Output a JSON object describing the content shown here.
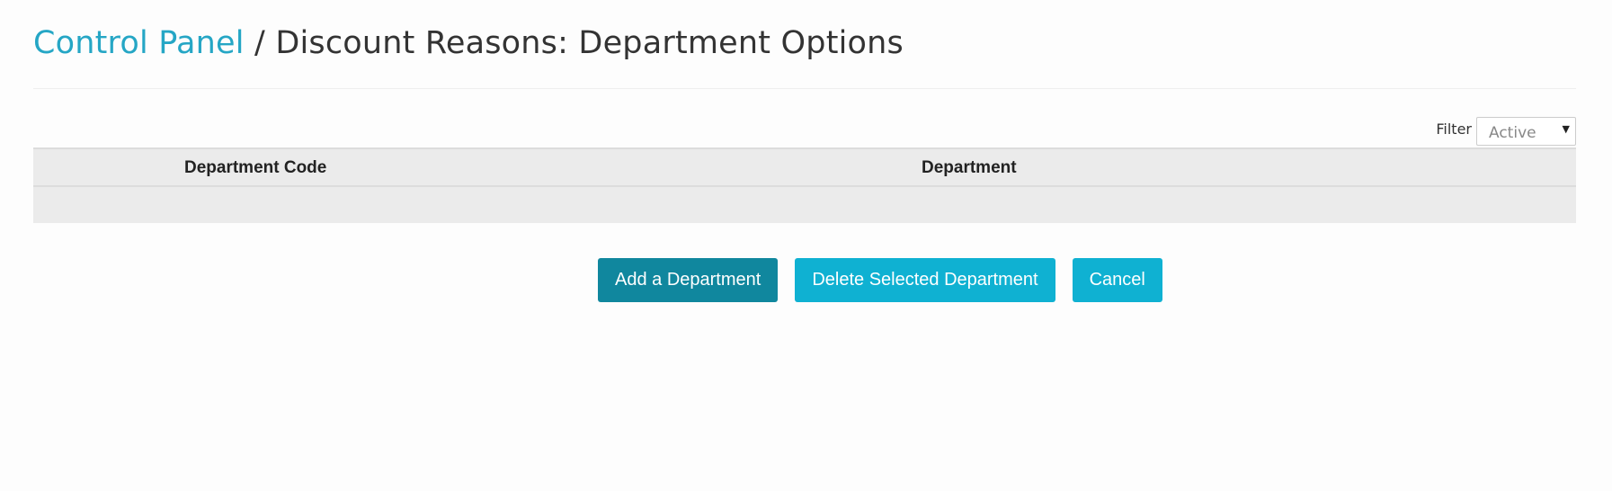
{
  "breadcrumb": {
    "root_label": "Control Panel",
    "separator": "/",
    "current_label": "Discount Reasons: Department Options"
  },
  "filter": {
    "label": "Filter",
    "selected": "Active"
  },
  "table": {
    "columns": [
      "Department Code",
      "Department"
    ],
    "rows": []
  },
  "actions": {
    "add_label": "Add a Department",
    "delete_label": "Delete Selected Department",
    "cancel_label": "Cancel"
  },
  "colors": {
    "link": "#25a6c5",
    "primary_button": "#10879e",
    "info_button": "#0fb1d2",
    "table_background": "#ebebeb"
  }
}
